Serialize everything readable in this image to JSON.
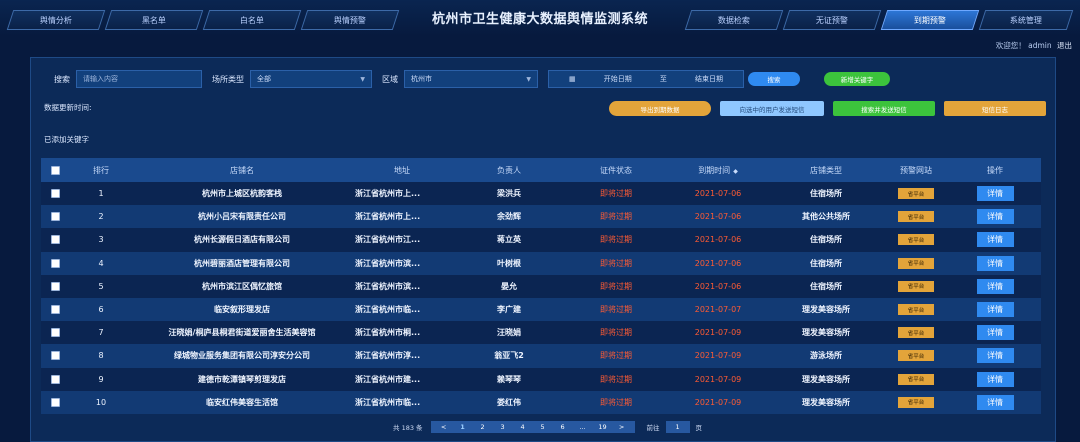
{
  "header": {
    "title": "杭州市卫生健康大数据舆情监测系统",
    "tabs_left": [
      "舆情分析",
      "黑名单",
      "白名单",
      "舆情预警"
    ],
    "tabs_right": [
      "数据检索",
      "无证预警",
      "到期预警",
      "系统管理"
    ],
    "active_tab": "到期预警",
    "welcome": "欢迎您！",
    "user": "admin",
    "logout": "退出"
  },
  "filters": {
    "search_label": "搜索",
    "search_placeholder": "请输入内容",
    "type_label": "场所类型",
    "type_value": "全部",
    "region_label": "区域",
    "region_value": "杭州市",
    "start_date": "开始日期",
    "date_sep": "至",
    "end_date": "结束日期",
    "search_button": "搜索",
    "add_keyword_button": "新增关键字"
  },
  "update_time_label": "数据更新时间:",
  "actions": {
    "export": "导出到期数据",
    "send_selected": "向选中的用户发送短信",
    "search_send": "搜索并发送短信",
    "sms_log": "短信日志"
  },
  "added_keywords_label": "已添加关键字",
  "table": {
    "headers": [
      "排行",
      "店铺名",
      "地址",
      "负责人",
      "证件状态",
      "到期时间",
      "店铺类型",
      "预警网站",
      "操作"
    ],
    "site_tag": "省平台",
    "detail_label": "详情",
    "rows": [
      {
        "no": "1",
        "name": "杭州市上城区杭韵客栈",
        "addr": "浙江省杭州市上...",
        "person": "梁洪兵",
        "status": "即将过期",
        "date": "2021-07-06",
        "type": "住宿场所"
      },
      {
        "no": "2",
        "name": "杭州小吕宋有限责任公司",
        "addr": "浙江省杭州市上...",
        "person": "余劲辉",
        "status": "即将过期",
        "date": "2021-07-06",
        "type": "其他公共场所"
      },
      {
        "no": "3",
        "name": "杭州长源假日酒店有限公司",
        "addr": "浙江省杭州市江...",
        "person": "蒋立英",
        "status": "即将过期",
        "date": "2021-07-06",
        "type": "住宿场所"
      },
      {
        "no": "4",
        "name": "杭州碧丽酒店管理有限公司",
        "addr": "浙江省杭州市滨...",
        "person": "叶树根",
        "status": "即将过期",
        "date": "2021-07-06",
        "type": "住宿场所"
      },
      {
        "no": "5",
        "name": "杭州市滨江区偶忆旅馆",
        "addr": "浙江省杭州市滨...",
        "person": "晏允",
        "status": "即将过期",
        "date": "2021-07-06",
        "type": "住宿场所"
      },
      {
        "no": "6",
        "name": "临安叙形理发店",
        "addr": "浙江省杭州市临...",
        "person": "李广建",
        "status": "即将过期",
        "date": "2021-07-07",
        "type": "理发美容场所"
      },
      {
        "no": "7",
        "name": "汪晓娟/桐庐县桐君街道爱丽舍生活美容馆",
        "addr": "浙江省杭州市桐...",
        "person": "汪晓娟",
        "status": "即将过期",
        "date": "2021-07-09",
        "type": "理发美容场所"
      },
      {
        "no": "8",
        "name": "绿城物业服务集团有限公司淳安分公司",
        "addr": "浙江省杭州市淳...",
        "person": "翁亚飞2",
        "status": "即将过期",
        "date": "2021-07-09",
        "type": "游泳场所"
      },
      {
        "no": "9",
        "name": "建德市乾潭镇琴剪理发店",
        "addr": "浙江省杭州市建...",
        "person": "赖琴琴",
        "status": "即将过期",
        "date": "2021-07-09",
        "type": "理发美容场所"
      },
      {
        "no": "10",
        "name": "临安红伟美容生活馆",
        "addr": "浙江省杭州市临...",
        "person": "娄红伟",
        "status": "即将过期",
        "date": "2021-07-09",
        "type": "理发美容场所"
      }
    ]
  },
  "pagination": {
    "total": "共 183 条",
    "prev": "<",
    "next": ">",
    "pages": [
      "1",
      "2",
      "3",
      "4",
      "5",
      "6",
      "...",
      "19"
    ],
    "current": "1",
    "goto_label": "前往",
    "goto_value": "1",
    "goto_suffix": "页"
  },
  "colors": {
    "background": "#071a3e",
    "panel": "#0c2a58",
    "accent_blue": "#2f8af0",
    "warning_red": "#ff5b33",
    "orange": "#e3a43a",
    "green": "#3cc33c"
  }
}
